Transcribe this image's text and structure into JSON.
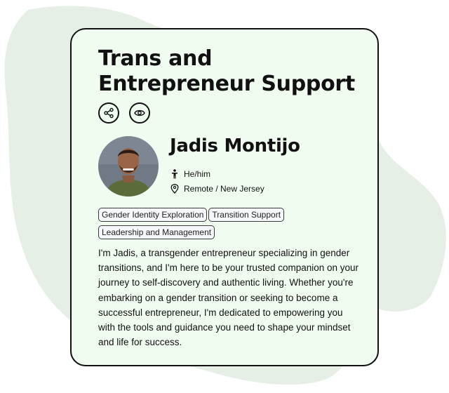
{
  "card": {
    "title": "Trans and Entrepreneur Support",
    "actions": [
      {
        "icon": "share-icon"
      },
      {
        "icon": "eye-icon"
      }
    ]
  },
  "coach": {
    "name": "Jadis Montijo",
    "pronouns": "He/him",
    "pronoun_icon": "person-icon",
    "location": "Remote / New Jersey",
    "location_icon": "map-pin-icon"
  },
  "tags": [
    "Gender Identity Exploration",
    "Transition Support",
    "Leadership and Management"
  ],
  "bio": "I'm Jadis, a transgender entrepreneur specializing in gender transitions, and I'm here to be your trusted companion on your journey to self-discovery and authentic living. Whether you're embarking on a gender transition or seeking to become a successful entrepreneur, I'm dedicated to empowering you with the tools and guidance you need to shape your mindset and life for success.",
  "colors": {
    "card_background": "#f1fcf1",
    "blob": "#e6efe6",
    "border": "#111111"
  }
}
